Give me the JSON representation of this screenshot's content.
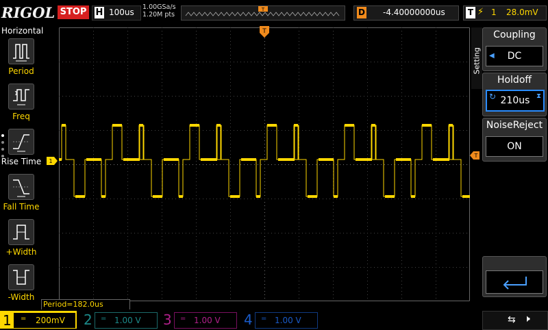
{
  "brand": "RIGOL",
  "run_state": "STOP",
  "horizontal": {
    "key": "H",
    "timebase": "100us"
  },
  "sampling": {
    "rate": "1.00GSa/s",
    "points": "1.20M pts"
  },
  "timeline_marker": "T",
  "delay": {
    "key": "D",
    "value": "-4.40000000us"
  },
  "trigger": {
    "key": "T",
    "slope": "⚡",
    "source": "1",
    "level": "28.0mV"
  },
  "left_menu": {
    "title": "Horizontal",
    "items": [
      {
        "label": "Period",
        "icon": "period-icon"
      },
      {
        "label": "Freq",
        "icon": "freq-icon"
      },
      {
        "label": "Rise Time",
        "icon": "rise-time-icon"
      },
      {
        "label": "Fall Time",
        "icon": "fall-time-icon"
      },
      {
        "label": "+Width",
        "icon": "pos-width-icon"
      },
      {
        "label": "-Width",
        "icon": "neg-width-icon"
      }
    ]
  },
  "measurement": "Period=182.0us",
  "channel1_marker": "1",
  "right_menu": {
    "setting_tab": "Setting",
    "coupling": {
      "title": "Coupling",
      "value": "DC"
    },
    "holdoff": {
      "title": "Holdoff",
      "value": "210us"
    },
    "noise_reject": {
      "title": "NoiseReject",
      "value": "ON"
    }
  },
  "channels": [
    {
      "number": "1",
      "coupling_icon": "=",
      "scale": "200mV",
      "color": "#ffd800"
    },
    {
      "number": "2",
      "coupling_icon": "=",
      "scale": "1.00 V",
      "color": "#1c8a8a"
    },
    {
      "number": "3",
      "coupling_icon": "=",
      "scale": "1.00 V",
      "color": "#b0208a"
    },
    {
      "number": "4",
      "coupling_icon": "=",
      "scale": "1.00 V",
      "color": "#1a5bc9"
    }
  ],
  "status_icons": [
    "usb-icon",
    "speaker-muted-icon"
  ],
  "colors": {
    "trace": "#ffd800",
    "trigger": "#f08a1c",
    "stop": "#d62020",
    "grid": "#555555"
  }
}
